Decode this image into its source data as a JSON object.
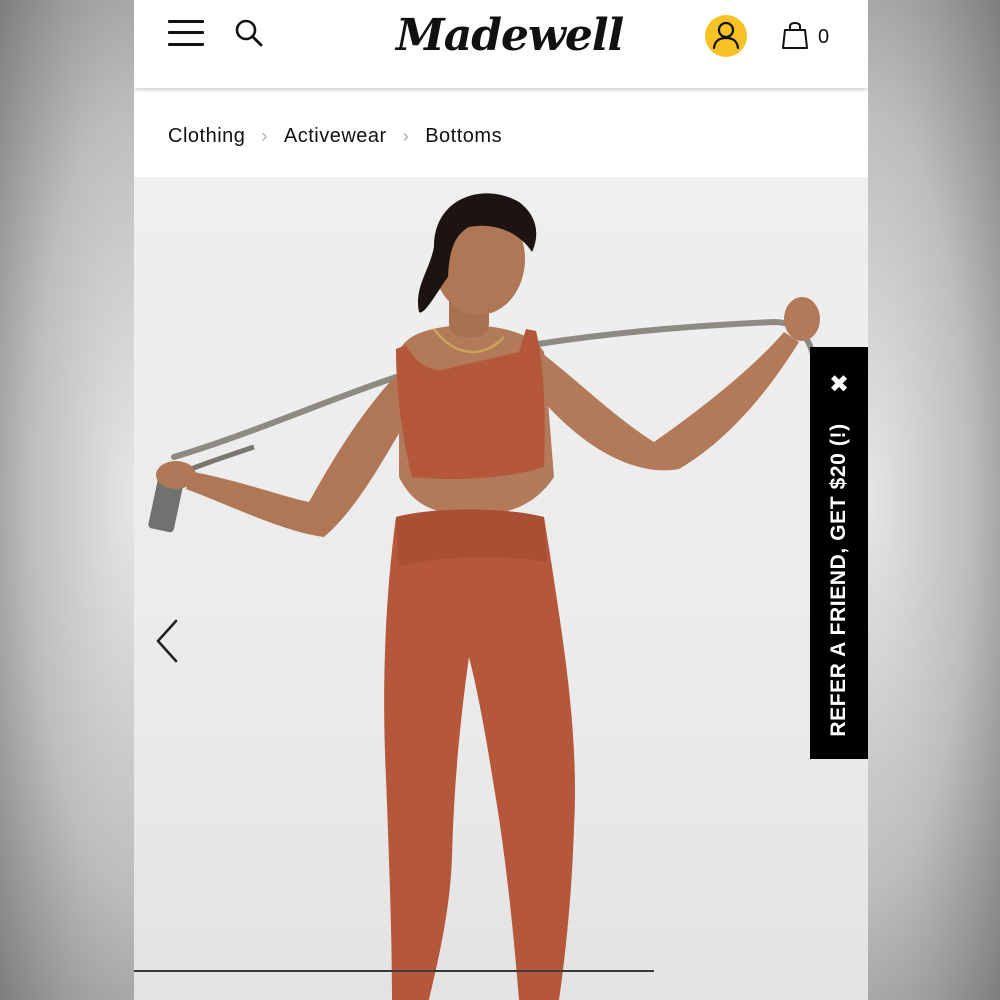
{
  "header": {
    "logo_text": "Madewell",
    "bag_count": "0"
  },
  "breadcrumb": {
    "items": [
      "Clothing",
      "Activewear",
      "Bottoms"
    ]
  },
  "promo": {
    "refer_label": "REFER A FRIEND, GET $20 (!)",
    "close_glyph": "✖"
  },
  "colors": {
    "accent": "#f6c226",
    "garment": "#b5573a",
    "promo_bg": "#000000"
  },
  "icons": [
    "menu-icon",
    "search-icon",
    "account-icon",
    "shopping-bag-icon",
    "chevron-left-icon",
    "close-icon",
    "chevron-right-icon"
  ]
}
